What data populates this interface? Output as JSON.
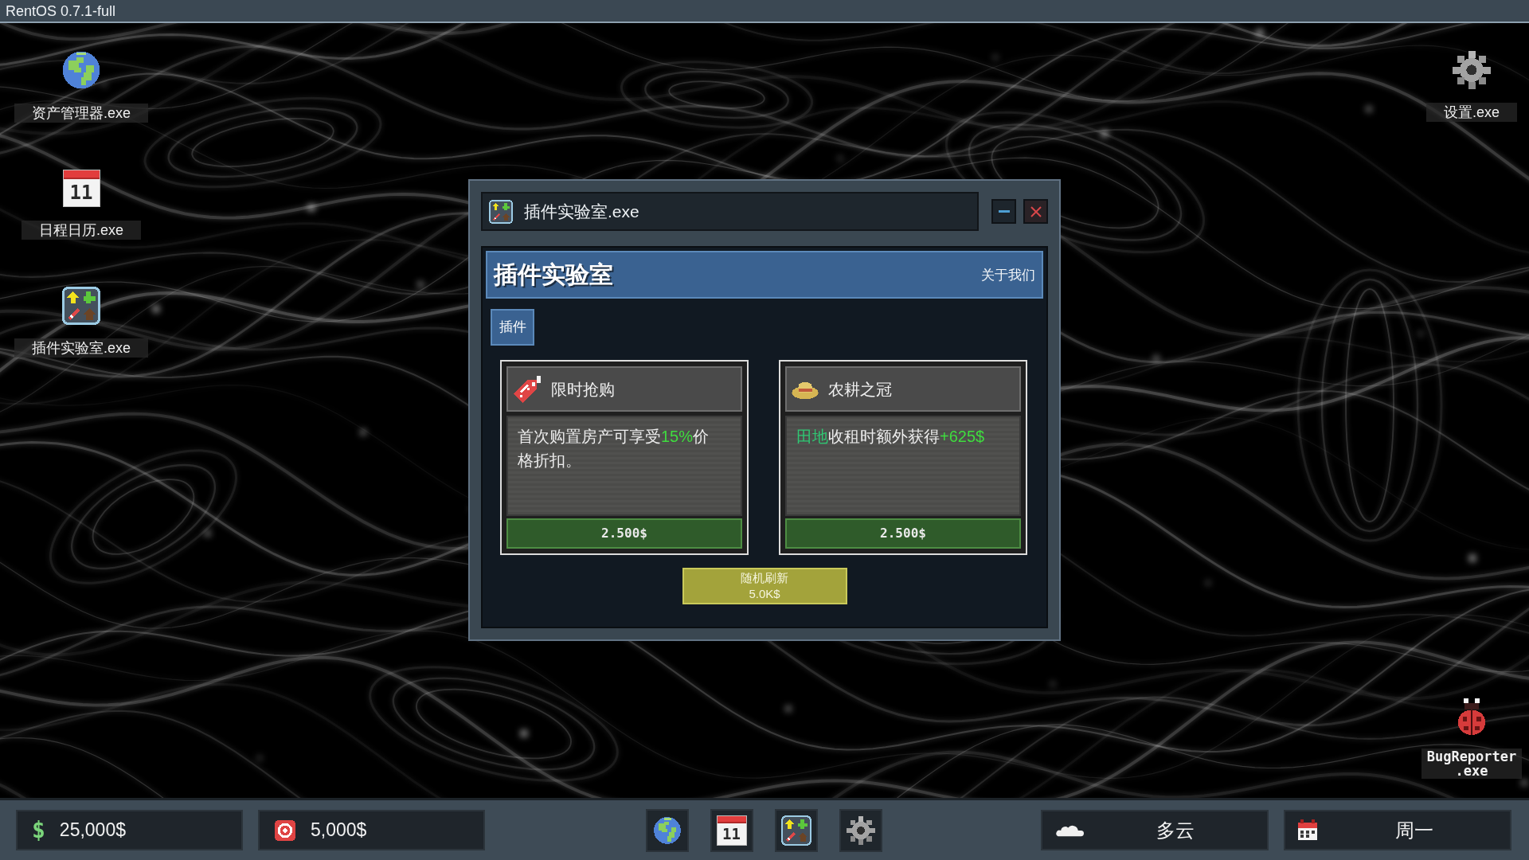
{
  "top_bar": {
    "title": "RentOS 0.7.1-full"
  },
  "desktop": {
    "left_icons": [
      {
        "kind": "assets",
        "label": "资产管理器.exe"
      },
      {
        "kind": "calendar",
        "label": "日程日历.exe",
        "day": "11"
      },
      {
        "kind": "plugins",
        "label": "插件实验室.exe"
      }
    ],
    "right_icons": [
      {
        "kind": "settings",
        "label": "设置.exe"
      },
      {
        "kind": "reporter",
        "label": "BugReporter.exe"
      }
    ]
  },
  "window": {
    "title": "插件实验室.exe",
    "app": {
      "heading": "插件实验室",
      "about_link": "关于我们",
      "tabs": [
        {
          "label": "插件",
          "selected": true
        }
      ],
      "plugins": [
        {
          "kind": "sale",
          "name": "限时抢购",
          "description": [
            {
              "kind": "plain",
              "text": "首次购置房产可享受"
            },
            {
              "kind": "value",
              "text": "15%"
            },
            {
              "kind": "plain",
              "text": "价格折扣。"
            }
          ],
          "price": "2.500$"
        },
        {
          "kind": "farming",
          "name": "农耕之冠",
          "description": [
            {
              "kind": "term",
              "text": "田地"
            },
            {
              "kind": "plain",
              "text": "收租时额外获得"
            },
            {
              "kind": "value",
              "text": "+625$"
            }
          ],
          "price": "2.500$"
        }
      ],
      "refresh_button": {
        "label": "随机刷新",
        "cost": "5.0K$"
      }
    }
  },
  "taskbar": {
    "counters": [
      {
        "kind": "cash",
        "symbol": "$",
        "amount": "25,000$"
      },
      {
        "kind": "target",
        "amount": "5,000$"
      }
    ],
    "apps": [
      {
        "kind": "assets"
      },
      {
        "kind": "calendar",
        "day": "11"
      },
      {
        "kind": "plugins"
      },
      {
        "kind": "settings"
      }
    ],
    "weather": "多云",
    "weekday": "周一"
  }
}
